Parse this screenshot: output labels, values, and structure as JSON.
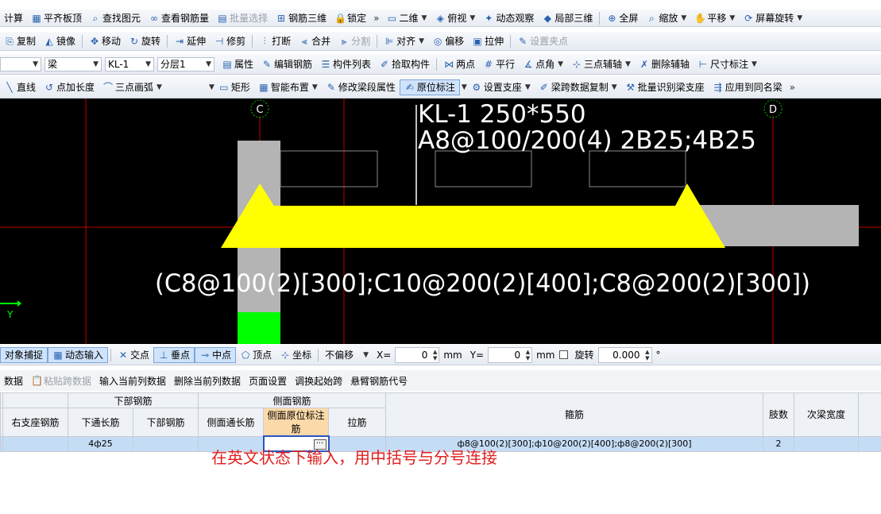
{
  "toolbar1": {
    "items": [
      "计算",
      "平齐板顶",
      "查找图元",
      "查看钢筋量",
      "批量选择",
      "钢筋三维",
      "锁定"
    ],
    "view": [
      "二维",
      "俯视",
      "动态观察",
      "局部三维",
      "全屏",
      "缩放",
      "平移",
      "屏幕旋转"
    ],
    "more": "»"
  },
  "toolbar2": {
    "items": [
      "复制",
      "镜像",
      "移动",
      "旋转",
      "延伸",
      "修剪",
      "打断",
      "合并",
      "分割",
      "对齐",
      "偏移",
      "拉伸",
      "设置夹点"
    ]
  },
  "toolbar3": {
    "combos": [
      "",
      "梁",
      "KL-1",
      "分层1"
    ],
    "items": [
      "属性",
      "编辑钢筋",
      "构件列表",
      "拾取构件",
      "两点",
      "平行",
      "点角",
      "三点辅轴",
      "删除辅轴",
      "尺寸标注"
    ]
  },
  "toolbar4": {
    "items": [
      "直线",
      "点加长度",
      "三点画弧",
      "矩形",
      "智能布置",
      "修改梁段属性",
      "原位标注",
      "设置支座",
      "梁跨数据复制",
      "批量识别梁支座",
      "应用到同名梁"
    ],
    "more": "»"
  },
  "canvas": {
    "axis_c": "C",
    "axis_d": "D",
    "beam_name": "KL-1 250*550",
    "beam_rebar": "A8@100/200(4) 2B25;4B25",
    "side_annotation": "(C8@100(2)[300];C10@200(2)[400];C8@200(2)[300])",
    "ucs_label": "Y"
  },
  "statusbar": {
    "snap": "对象捕捉",
    "dynamic_input": "动态输入",
    "snaps": [
      "交点",
      "垂点",
      "中点",
      "顶点",
      "坐标"
    ],
    "offset": "不偏移",
    "x_label": "X=",
    "x_value": "0",
    "x_unit": "mm",
    "y_label": "Y=",
    "y_value": "0",
    "y_unit": "mm",
    "rotate_label": "旋转",
    "rotate_value": "0.000",
    "degree": "°"
  },
  "tablebar": {
    "items": [
      "数据",
      "粘贴跨数据",
      "输入当前列数据",
      "删除当前列数据",
      "页面设置",
      "调换起始跨",
      "悬臂钢筋代号"
    ]
  },
  "grid": {
    "group_headers": [
      "",
      "下部钢筋",
      "侧面钢筋",
      "箍筋",
      "肢数",
      "次梁宽度"
    ],
    "headers": [
      "右支座钢筋",
      "下通长筋",
      "下部钢筋",
      "侧面通长筋",
      "侧面原位标注筋",
      "拉筋"
    ],
    "row": {
      "right_support": "",
      "bottom_through": "4ф25",
      "bottom": "",
      "side_through": "",
      "side_original": "",
      "tie": "",
      "stirrup": "ф8@100(2)[300];ф10@200(2)[400];ф8@200(2)[300]",
      "legs": "2",
      "secondary_width": ""
    },
    "ellipsis": "···"
  },
  "note": "在英文状态下输入，用中括号与分号连接"
}
